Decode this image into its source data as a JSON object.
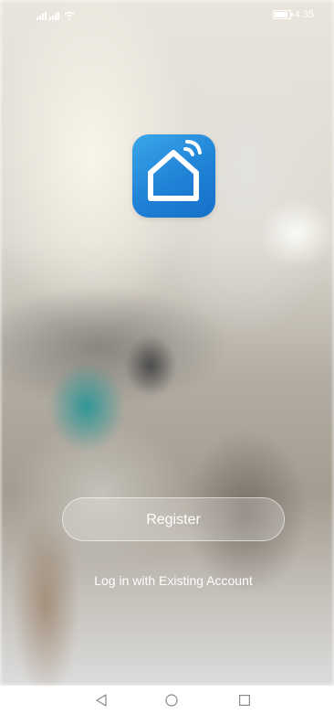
{
  "status_bar": {
    "time": "4:35",
    "icons": [
      "signal-icon",
      "signal-icon",
      "wifi-icon",
      "battery-icon"
    ]
  },
  "app_logo": {
    "icon": "smart-home-icon",
    "colors": {
      "gradient_start": "#3aa6ea",
      "gradient_end": "#1570c7",
      "glyph": "#ffffff"
    }
  },
  "actions": {
    "register_label": "Register",
    "login_label": "Log in with Existing Account"
  },
  "nav_bar": {
    "icons": [
      "back-icon",
      "home-icon",
      "recent-apps-icon"
    ]
  }
}
